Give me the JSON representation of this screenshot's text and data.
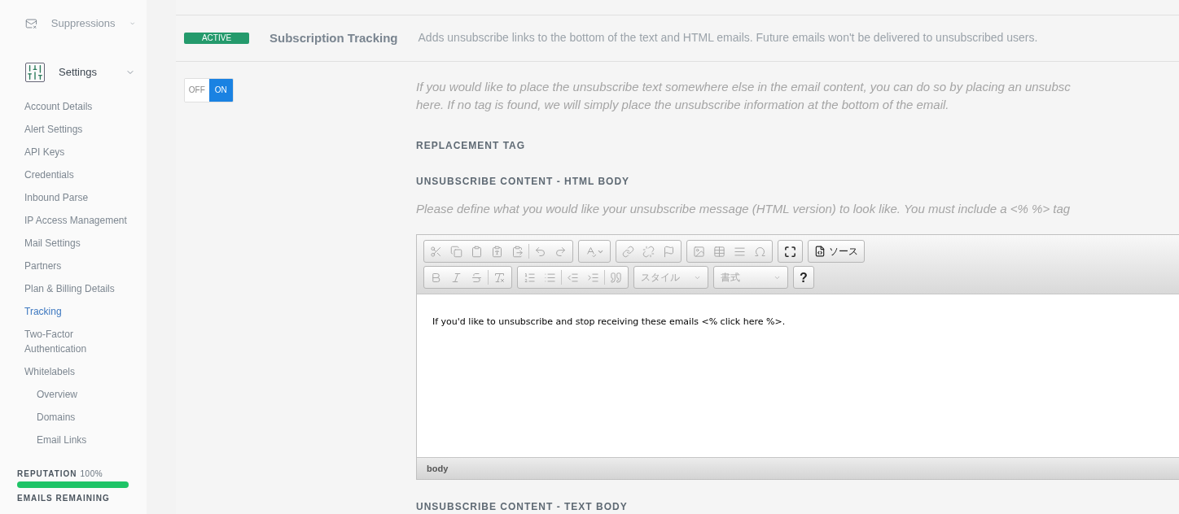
{
  "sidebar": {
    "sections": [
      {
        "label": "Suppressions",
        "selected": false
      },
      {
        "label": "Settings",
        "selected": true,
        "items": [
          {
            "label": "Account Details",
            "selected": false
          },
          {
            "label": "Alert Settings",
            "selected": false
          },
          {
            "label": "API Keys",
            "selected": false
          },
          {
            "label": "Credentials",
            "selected": false
          },
          {
            "label": "Inbound Parse",
            "selected": false
          },
          {
            "label": "IP Access Management",
            "selected": false
          },
          {
            "label": "Mail Settings",
            "selected": false
          },
          {
            "label": "Partners",
            "selected": false
          },
          {
            "label": "Plan & Billing Details",
            "selected": false
          },
          {
            "label": "Tracking",
            "selected": true
          },
          {
            "label": "Two-Factor Authentication",
            "selected": false
          },
          {
            "label": "Whitelabels",
            "selected": false,
            "children": [
              {
                "label": "Overview",
                "selected": false
              },
              {
                "label": "Domains",
                "selected": false
              },
              {
                "label": "Email Links",
                "selected": false
              }
            ]
          }
        ]
      }
    ],
    "reputation": {
      "label": "REPUTATION",
      "value": "100%",
      "level": 1
    },
    "emails_remaining": {
      "label": "EMAILS REMAINING"
    }
  },
  "setting": {
    "badge": "ACTIVE",
    "active": true,
    "title": "Subscription Tracking",
    "description": "Adds unsubscribe links to the bottom of the text and HTML emails. Future emails won't be delivered to unsubscribed users."
  },
  "toggle": {
    "off_label": "OFF",
    "on_label": "ON",
    "on": true
  },
  "intro_lines": [
    "If you would like to place the unsubscribe text somewhere else in the email content, you can do so by placing an unsubsc",
    "here. If no tag is found, we will simply place the unsubscribe information at the bottom of the email."
  ],
  "replacement_tag": {
    "label": "REPLACEMENT TAG"
  },
  "html_body": {
    "label": "UNSUBSCRIBE CONTENT - HTML BODY",
    "hint": "Please define what you would like your unsubscribe message (HTML version) to look like. You must include a <% %> tag",
    "editor": {
      "toolbar_rows": [
        [
          [
            {
              "kind": "icon",
              "disabled": true
            },
            {
              "kind": "icon",
              "disabled": true
            },
            {
              "kind": "icon",
              "disabled": true
            },
            {
              "kind": "icon",
              "disabled": true
            },
            {
              "kind": "icon",
              "disabled": true
            },
            {
              "kind": "separator"
            },
            {
              "kind": "icon",
              "disabled": true
            },
            {
              "kind": "icon",
              "disabled": true
            }
          ],
          [
            {
              "kind": "icon",
              "disabled": true
            }
          ],
          [
            {
              "kind": "icon",
              "disabled": true
            },
            {
              "kind": "icon",
              "disabled": true
            },
            {
              "kind": "icon",
              "disabled": true
            }
          ],
          [
            {
              "kind": "icon",
              "disabled": true
            },
            {
              "kind": "icon",
              "disabled": true
            },
            {
              "kind": "icon",
              "disabled": true
            },
            {
              "kind": "icon",
              "disabled": true
            }
          ],
          [
            {
              "kind": "icon",
              "disabled": false
            }
          ],
          [
            {
              "kind": "button",
              "label": "ソース",
              "disabled": false
            }
          ]
        ],
        [
          [
            {
              "kind": "icon",
              "disabled": true
            },
            {
              "kind": "icon",
              "disabled": true
            },
            {
              "kind": "icon",
              "disabled": true
            },
            {
              "kind": "separator"
            },
            {
              "kind": "icon",
              "disabled": true
            }
          ],
          [
            {
              "kind": "icon",
              "disabled": true
            },
            {
              "kind": "icon",
              "disabled": true
            },
            {
              "kind": "separator"
            },
            {
              "kind": "icon",
              "disabled": true
            },
            {
              "kind": "icon",
              "disabled": true
            },
            {
              "kind": "separator"
            },
            {
              "kind": "icon",
              "disabled": true
            }
          ],
          [
            {
              "kind": "select",
              "label": "スタイル",
              "disabled": true
            }
          ],
          [
            {
              "kind": "select",
              "label": "書式",
              "disabled": true
            }
          ],
          [
            {
              "kind": "text",
              "label": "?",
              "disabled": false
            }
          ]
        ]
      ],
      "content": "If you'd like to unsubscribe and stop receiving these emails <% click here %>.",
      "status": "body"
    }
  },
  "text_body": {
    "label": "UNSUBSCRIBE CONTENT - TEXT BODY"
  }
}
